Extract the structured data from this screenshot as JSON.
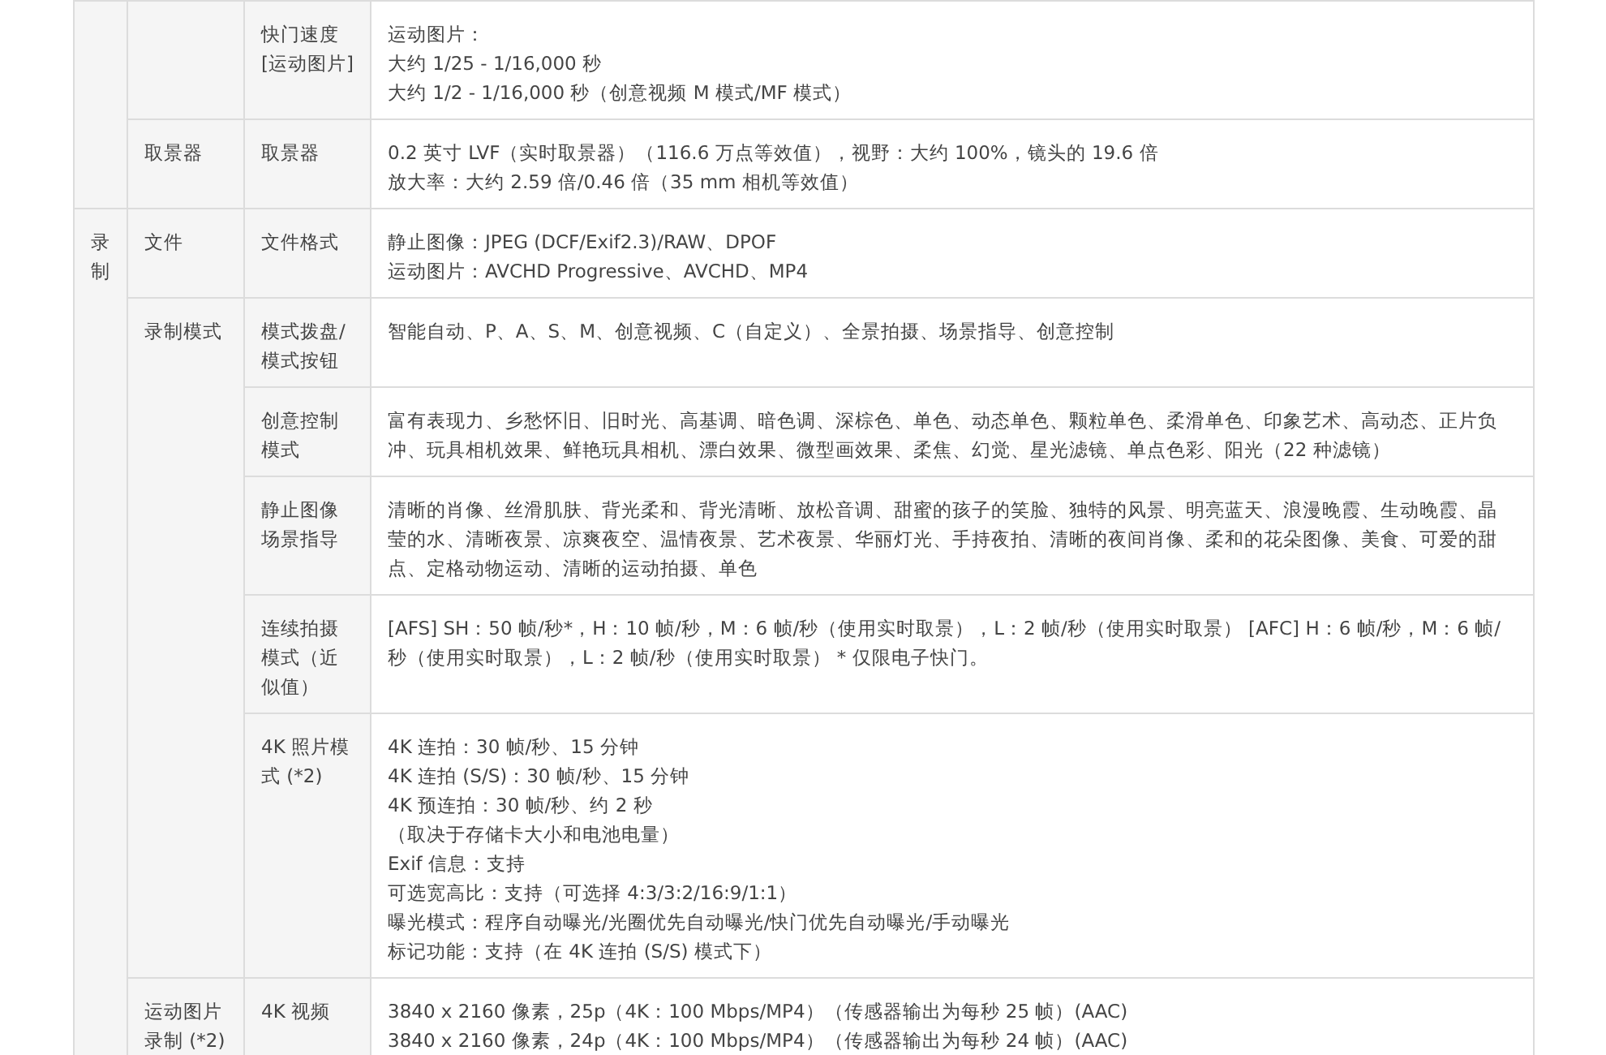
{
  "spec_table": {
    "groups": [
      {
        "sections": [
          {
            "rows": [
              {
                "name": [
                  "快门速度",
                  "[运动图片]"
                ],
                "value": [
                  "运动图片：",
                  "大约 1/25 - 1/16,000 秒",
                  "大约 1/2 - 1/16,000 秒（创意视频 M 模式/MF 模式）"
                ]
              }
            ]
          },
          {
            "label": [
              "取景器"
            ],
            "rows": [
              {
                "name": [
                  "取景器"
                ],
                "value": [
                  "0.2 英寸 LVF（实时取景器）（116.6 万点等效值），视野：大约 100%，镜头的 19.6 倍",
                  "放大率：大约 2.59 倍/0.46 倍（35 mm 相机等效值）"
                ]
              }
            ]
          }
        ]
      },
      {
        "label": "录制",
        "sections": [
          {
            "label": [
              "文件"
            ],
            "rows": [
              {
                "name": [
                  "文件格式"
                ],
                "value": [
                  "静止图像：JPEG (DCF/Exif2.3)/RAW、DPOF",
                  "运动图片：AVCHD Progressive、AVCHD、MP4"
                ]
              }
            ]
          },
          {
            "label": [
              "录制模式"
            ],
            "rows": [
              {
                "name": [
                  "模式拨盘/",
                  "模式按钮"
                ],
                "value": [
                  "智能自动、P、A、S、M、创意视频、C（自定义）、全景拍摄、场景指导、创意控制"
                ]
              },
              {
                "name": [
                  "创意控制",
                  "模式"
                ],
                "value": [
                  "富有表现力、乡愁怀旧、旧时光、高基调、暗色调、深棕色、单色、动态单色、颗粒单色、柔滑单色、印象艺术、高动态、正片负冲、玩具相机效果、鲜艳玩具相机、漂白效果、微型画效果、柔焦、幻觉、星光滤镜、单点色彩、阳光（22 种滤镜）"
                ]
              },
              {
                "name": [
                  "静止图像",
                  "场景指导"
                ],
                "value": [
                  "清晰的肖像、丝滑肌肤、背光柔和、背光清晰、放松音调、甜蜜的孩子的笑脸、独特的风景、明亮蓝天、浪漫晚霞、生动晚霞、晶莹的水、清晰夜景、凉爽夜空、温情夜景、艺术夜景、华丽灯光、手持夜拍、清晰的夜间肖像、柔和的花朵图像、美食、可爱的甜点、定格动物运动、清晰的运动拍摄、单色"
                ]
              },
              {
                "name": [
                  "连续拍摄",
                  "模式（近",
                  "似值）"
                ],
                "value": [
                  "[AFS] SH：50 帧/秒*，H：10 帧/秒，M：6 帧/秒（使用实时取景），L：2 帧/秒（使用实时取景） [AFC] H：6 帧/秒，M：6 帧/秒（使用实时取景），L：2 帧/秒（使用实时取景） * 仅限电子快门。"
                ]
              },
              {
                "name": [
                  "4K 照片模",
                  "式 (*2)"
                ],
                "value": [
                  "4K 连拍：30 帧/秒、15 分钟",
                  "4K 连拍 (S/S)：30 帧/秒、15 分钟",
                  "4K 预连拍：30 帧/秒、约 2 秒",
                  "（取决于存储卡大小和电池电量）",
                  "Exif 信息：支持",
                  "可选宽高比：支持（可选择 4:3/3:2/16:9/1:1）",
                  "曝光模式：程序自动曝光/光圈优先自动曝光/快门优先自动曝光/手动曝光",
                  "标记功能：支持（在 4K 连拍 (S/S) 模式下）"
                ]
              }
            ]
          },
          {
            "label": [
              "运动图片",
              "录制 (*2)"
            ],
            "rows": [
              {
                "name": [
                  "4K 视频"
                ],
                "value": [
                  "3840 x 2160 像素，25p（4K：100 Mbps/MP4）（传感器输出为每秒 25 帧）(AAC)",
                  "3840 x 2160 像素，24p（4K：100 Mbps/MP4）（传感器输出为每秒 24 帧）(AAC)"
                ]
              }
            ]
          }
        ]
      }
    ]
  }
}
